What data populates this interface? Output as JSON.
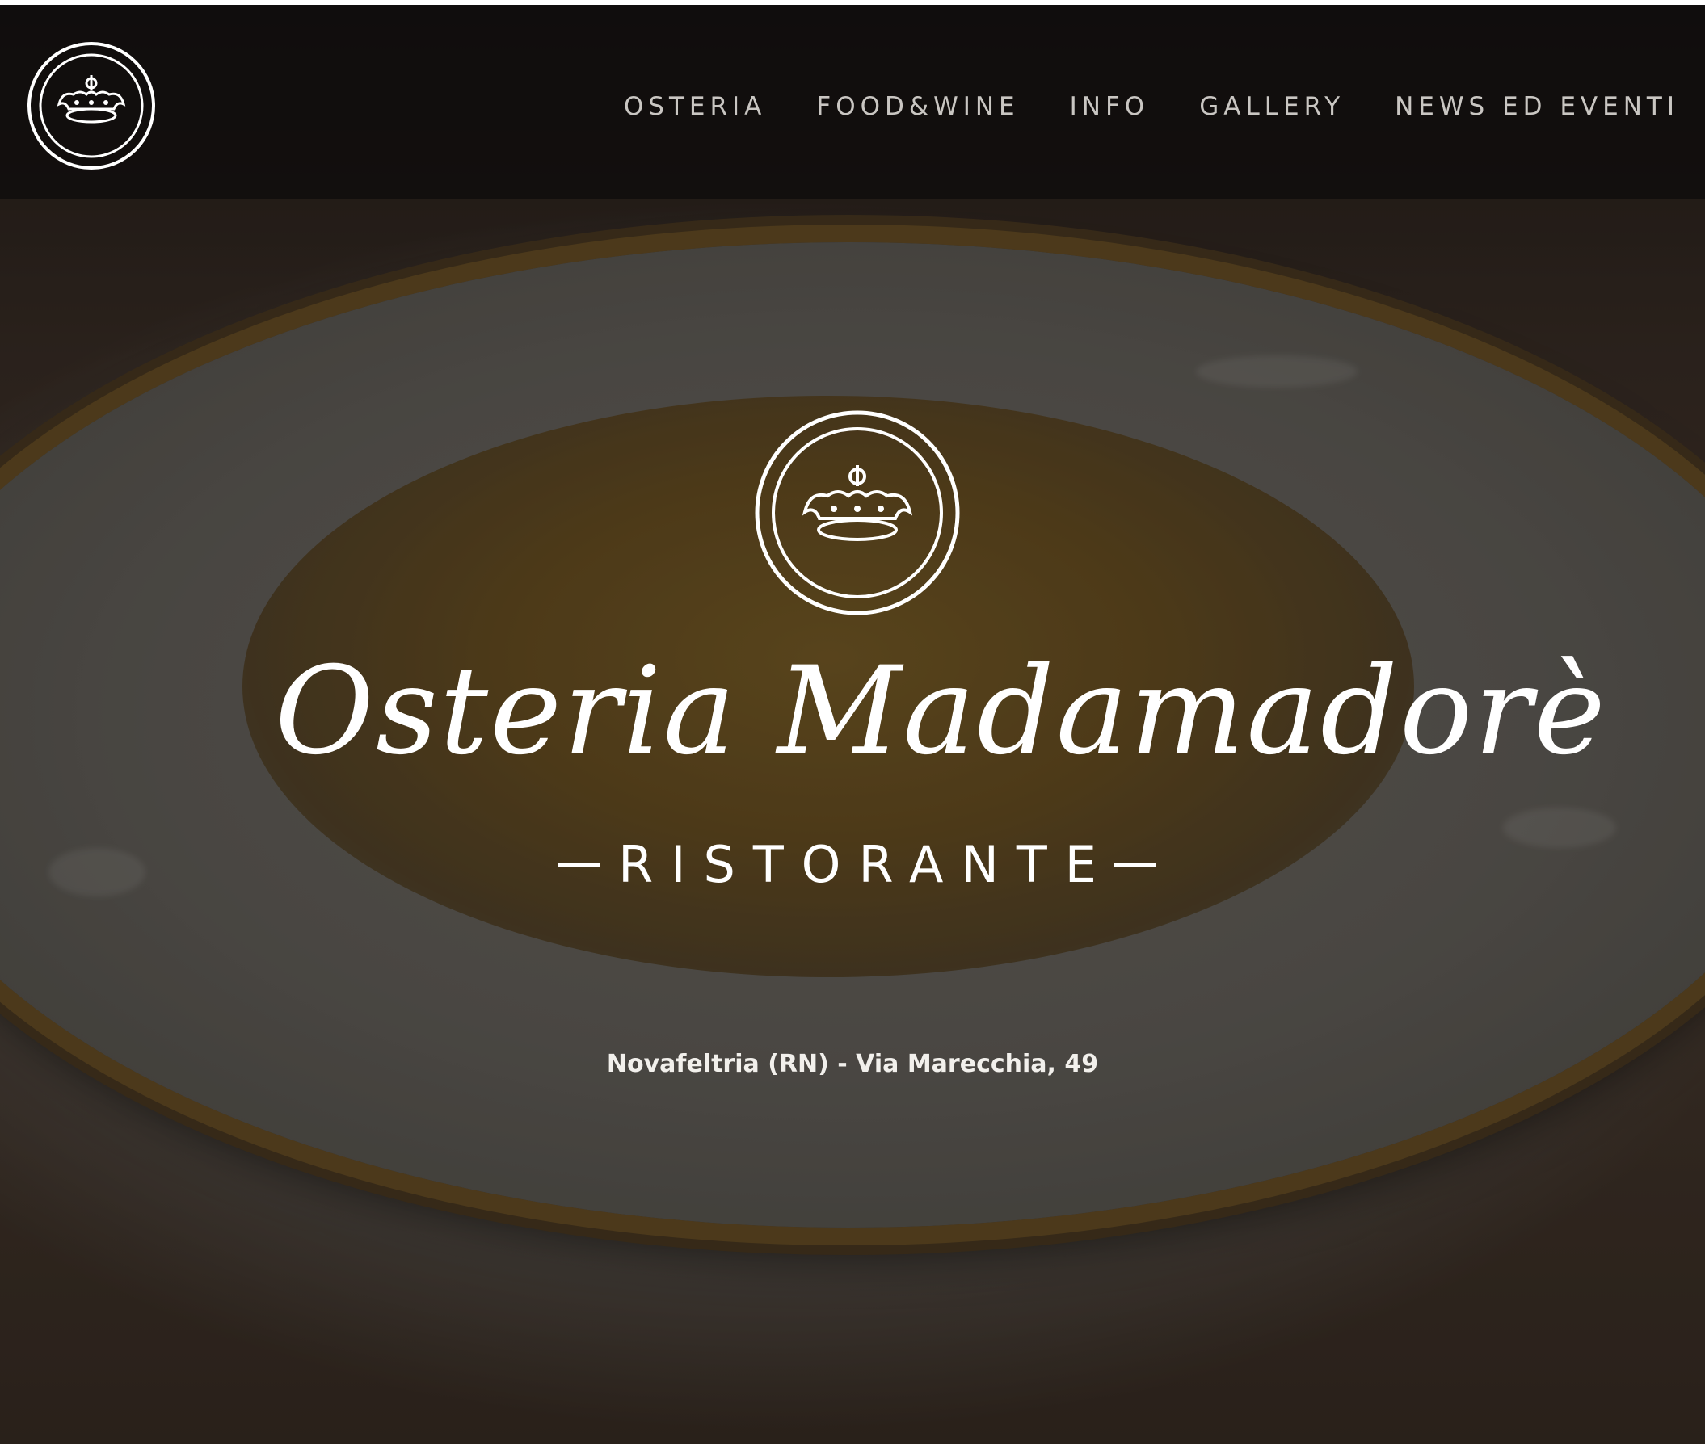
{
  "brand": {
    "logo_icon": "crown-emblem-icon",
    "name": "Osteria Madamadorè",
    "tagline": "RISTORANTE",
    "address": "Novafeltria (RN) - Via Marecchia, 49"
  },
  "nav": {
    "items": [
      {
        "label": "OSTERIA"
      },
      {
        "label": "FOOD&WINE"
      },
      {
        "label": "INFO"
      },
      {
        "label": "GALLERY"
      },
      {
        "label": "NEWS ED EVENTI"
      }
    ]
  },
  "colors": {
    "nav_bar": "#0e0c0b",
    "nav_text": "#c9c6c2",
    "brand_text": "#ffffff"
  }
}
